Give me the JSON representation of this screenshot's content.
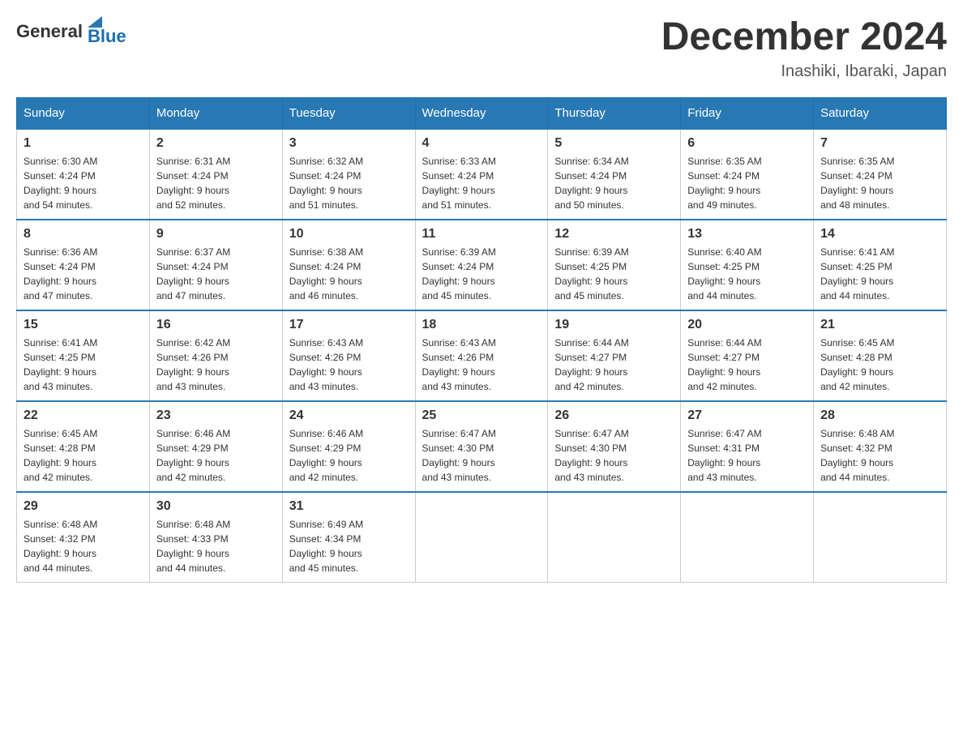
{
  "header": {
    "logo": {
      "general": "General",
      "blue": "Blue"
    },
    "title": "December 2024",
    "location": "Inashiki, Ibaraki, Japan"
  },
  "calendar": {
    "days_of_week": [
      "Sunday",
      "Monday",
      "Tuesday",
      "Wednesday",
      "Thursday",
      "Friday",
      "Saturday"
    ],
    "weeks": [
      [
        {
          "day": "1",
          "sunrise": "6:30 AM",
          "sunset": "4:24 PM",
          "daylight": "9 hours and 54 minutes."
        },
        {
          "day": "2",
          "sunrise": "6:31 AM",
          "sunset": "4:24 PM",
          "daylight": "9 hours and 52 minutes."
        },
        {
          "day": "3",
          "sunrise": "6:32 AM",
          "sunset": "4:24 PM",
          "daylight": "9 hours and 51 minutes."
        },
        {
          "day": "4",
          "sunrise": "6:33 AM",
          "sunset": "4:24 PM",
          "daylight": "9 hours and 51 minutes."
        },
        {
          "day": "5",
          "sunrise": "6:34 AM",
          "sunset": "4:24 PM",
          "daylight": "9 hours and 50 minutes."
        },
        {
          "day": "6",
          "sunrise": "6:35 AM",
          "sunset": "4:24 PM",
          "daylight": "9 hours and 49 minutes."
        },
        {
          "day": "7",
          "sunrise": "6:35 AM",
          "sunset": "4:24 PM",
          "daylight": "9 hours and 48 minutes."
        }
      ],
      [
        {
          "day": "8",
          "sunrise": "6:36 AM",
          "sunset": "4:24 PM",
          "daylight": "9 hours and 47 minutes."
        },
        {
          "day": "9",
          "sunrise": "6:37 AM",
          "sunset": "4:24 PM",
          "daylight": "9 hours and 47 minutes."
        },
        {
          "day": "10",
          "sunrise": "6:38 AM",
          "sunset": "4:24 PM",
          "daylight": "9 hours and 46 minutes."
        },
        {
          "day": "11",
          "sunrise": "6:39 AM",
          "sunset": "4:24 PM",
          "daylight": "9 hours and 45 minutes."
        },
        {
          "day": "12",
          "sunrise": "6:39 AM",
          "sunset": "4:25 PM",
          "daylight": "9 hours and 45 minutes."
        },
        {
          "day": "13",
          "sunrise": "6:40 AM",
          "sunset": "4:25 PM",
          "daylight": "9 hours and 44 minutes."
        },
        {
          "day": "14",
          "sunrise": "6:41 AM",
          "sunset": "4:25 PM",
          "daylight": "9 hours and 44 minutes."
        }
      ],
      [
        {
          "day": "15",
          "sunrise": "6:41 AM",
          "sunset": "4:25 PM",
          "daylight": "9 hours and 43 minutes."
        },
        {
          "day": "16",
          "sunrise": "6:42 AM",
          "sunset": "4:26 PM",
          "daylight": "9 hours and 43 minutes."
        },
        {
          "day": "17",
          "sunrise": "6:43 AM",
          "sunset": "4:26 PM",
          "daylight": "9 hours and 43 minutes."
        },
        {
          "day": "18",
          "sunrise": "6:43 AM",
          "sunset": "4:26 PM",
          "daylight": "9 hours and 43 minutes."
        },
        {
          "day": "19",
          "sunrise": "6:44 AM",
          "sunset": "4:27 PM",
          "daylight": "9 hours and 42 minutes."
        },
        {
          "day": "20",
          "sunrise": "6:44 AM",
          "sunset": "4:27 PM",
          "daylight": "9 hours and 42 minutes."
        },
        {
          "day": "21",
          "sunrise": "6:45 AM",
          "sunset": "4:28 PM",
          "daylight": "9 hours and 42 minutes."
        }
      ],
      [
        {
          "day": "22",
          "sunrise": "6:45 AM",
          "sunset": "4:28 PM",
          "daylight": "9 hours and 42 minutes."
        },
        {
          "day": "23",
          "sunrise": "6:46 AM",
          "sunset": "4:29 PM",
          "daylight": "9 hours and 42 minutes."
        },
        {
          "day": "24",
          "sunrise": "6:46 AM",
          "sunset": "4:29 PM",
          "daylight": "9 hours and 42 minutes."
        },
        {
          "day": "25",
          "sunrise": "6:47 AM",
          "sunset": "4:30 PM",
          "daylight": "9 hours and 43 minutes."
        },
        {
          "day": "26",
          "sunrise": "6:47 AM",
          "sunset": "4:30 PM",
          "daylight": "9 hours and 43 minutes."
        },
        {
          "day": "27",
          "sunrise": "6:47 AM",
          "sunset": "4:31 PM",
          "daylight": "9 hours and 43 minutes."
        },
        {
          "day": "28",
          "sunrise": "6:48 AM",
          "sunset": "4:32 PM",
          "daylight": "9 hours and 44 minutes."
        }
      ],
      [
        {
          "day": "29",
          "sunrise": "6:48 AM",
          "sunset": "4:32 PM",
          "daylight": "9 hours and 44 minutes."
        },
        {
          "day": "30",
          "sunrise": "6:48 AM",
          "sunset": "4:33 PM",
          "daylight": "9 hours and 44 minutes."
        },
        {
          "day": "31",
          "sunrise": "6:49 AM",
          "sunset": "4:34 PM",
          "daylight": "9 hours and 45 minutes."
        },
        null,
        null,
        null,
        null
      ]
    ]
  }
}
